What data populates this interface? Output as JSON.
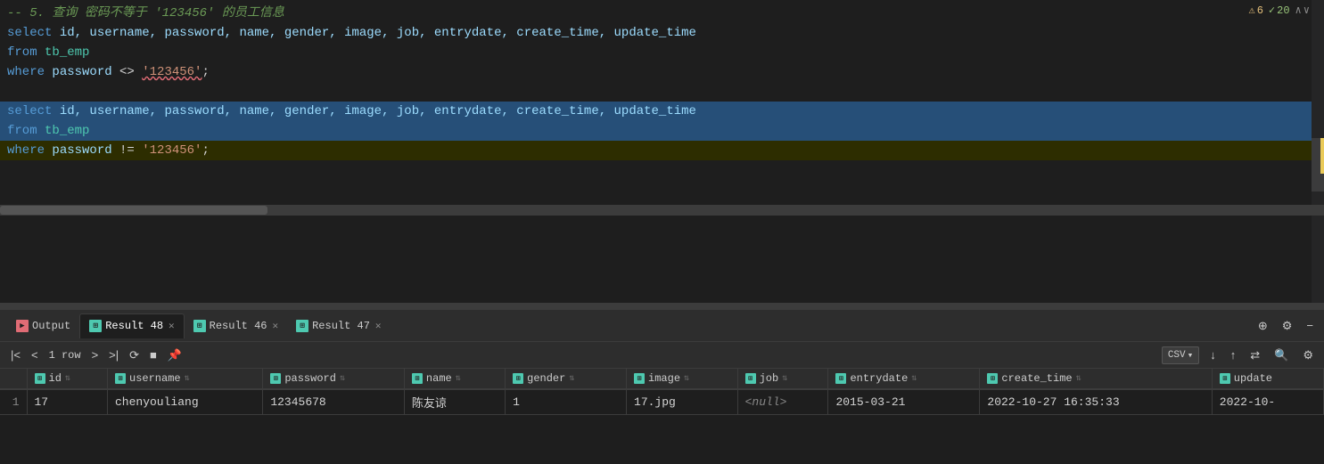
{
  "editor": {
    "warnings": {
      "warning_icon": "⚠",
      "warning_count": "6",
      "check_icon": "✓",
      "check_count": "20",
      "arrow_up": "∧",
      "arrow_down": "∨"
    },
    "block1": {
      "comment": "-- 5. 查询 密码不等于 '123456' 的员工信息",
      "line1": "select id, username, password, name, gender, image, job, entrydate, create_time, update_time",
      "line2": "from tb_emp",
      "line3_kw": "where",
      "line3_rest": " password <> ",
      "line3_str": "'123456'",
      "line3_end": ";"
    },
    "block2": {
      "line1": "select id, username, password, name, gender, image, job, entrydate, create_time, update_time",
      "line2_kw": "from",
      "line2_rest": " tb_emp",
      "line3_kw": "where",
      "line3_rest": " password != ",
      "line3_str": "'123456'",
      "line3_end": ";"
    }
  },
  "tabs": [
    {
      "id": "output",
      "label": "Output",
      "type": "output",
      "active": false,
      "closeable": false
    },
    {
      "id": "result48",
      "label": "Result 48",
      "type": "result",
      "active": true,
      "closeable": true
    },
    {
      "id": "result46",
      "label": "Result 46",
      "type": "result",
      "active": false,
      "closeable": true
    },
    {
      "id": "result47",
      "label": "Result 47",
      "type": "result",
      "active": false,
      "closeable": true
    }
  ],
  "toolbar": {
    "first_label": "|<",
    "prev_label": "<",
    "row_info": "1 row",
    "next_label": ">",
    "last_label": ">|",
    "refresh_label": "⟳",
    "stop_label": "■",
    "pin_label": "⚲",
    "csv_label": "CSV",
    "csv_arrow": "∨",
    "download_label": "↓",
    "upload_label": "↑",
    "sync_label": "⇄",
    "search_label": "🔍",
    "settings_label": "⚙"
  },
  "table": {
    "columns": [
      {
        "id": "id",
        "label": "id"
      },
      {
        "id": "username",
        "label": "username"
      },
      {
        "id": "password",
        "label": "password"
      },
      {
        "id": "name",
        "label": "name"
      },
      {
        "id": "gender",
        "label": "gender"
      },
      {
        "id": "image",
        "label": "image"
      },
      {
        "id": "job",
        "label": "job"
      },
      {
        "id": "entrydate",
        "label": "entrydate"
      },
      {
        "id": "create_time",
        "label": "create_time"
      },
      {
        "id": "update",
        "label": "update"
      }
    ],
    "rows": [
      {
        "rownum": "1",
        "id": "17",
        "username": "chenyouliang",
        "password": "12345678",
        "name": "陈友谅",
        "gender": "1",
        "image": "17.jpg",
        "job": "",
        "entrydate": "2015-03-21",
        "create_time": "2022-10-27 16:35:33",
        "update": "2022-10-"
      }
    ]
  }
}
